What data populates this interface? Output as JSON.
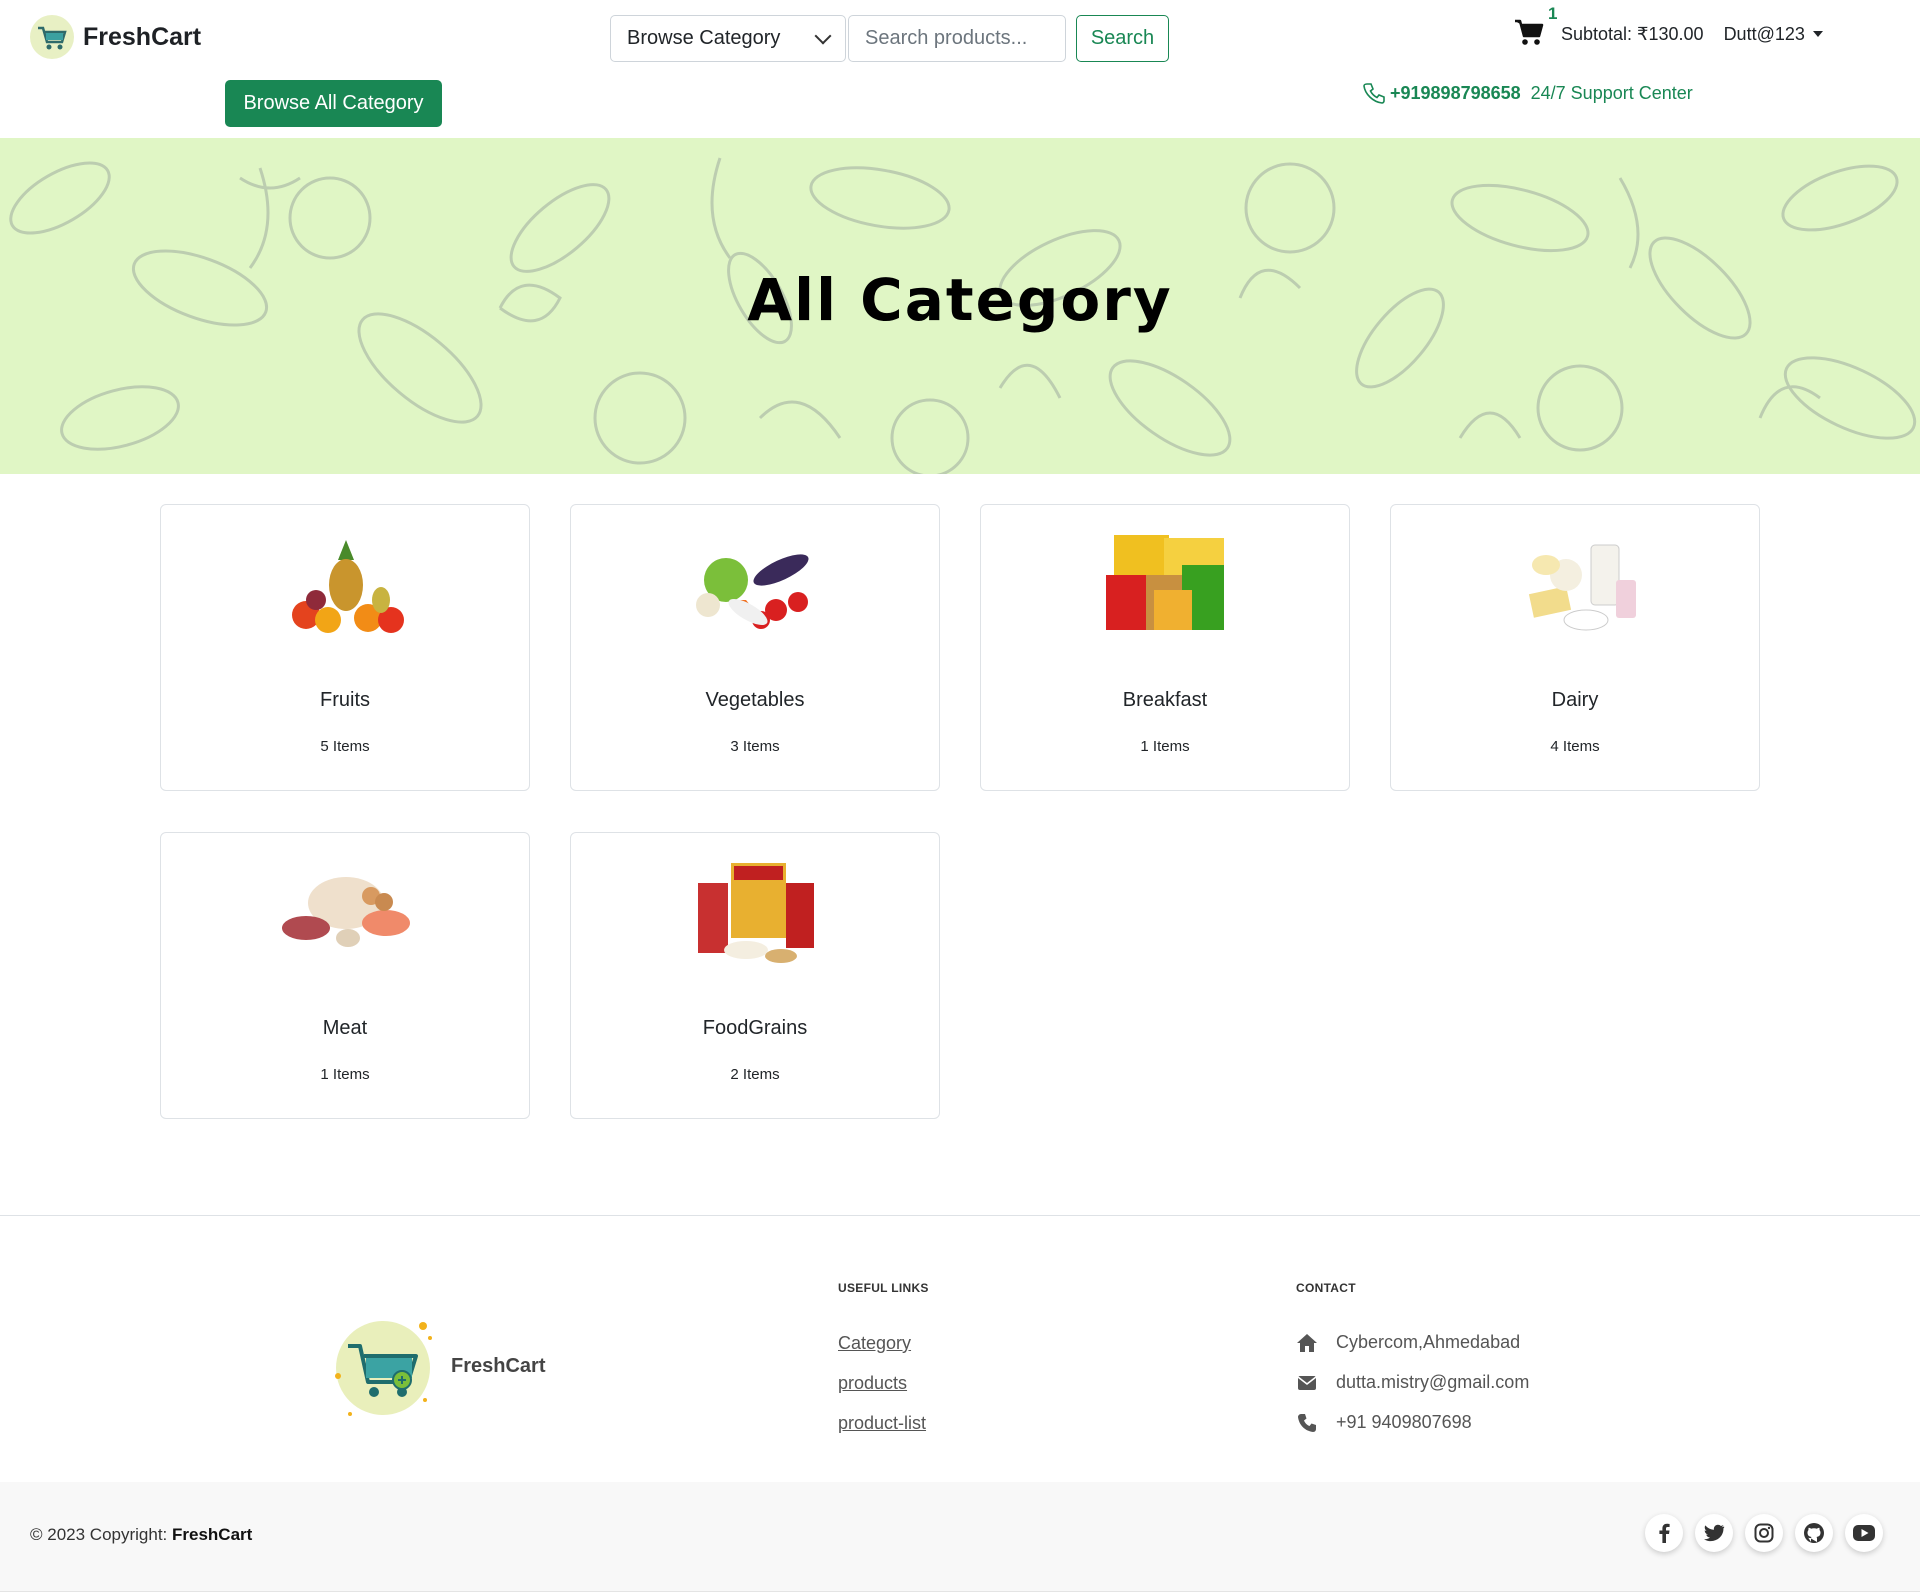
{
  "header": {
    "brand_name": "FreshCart",
    "category_select": "Browse Category",
    "search_placeholder": "Search products...",
    "search_button": "Search",
    "cart_count": "1",
    "subtotal": "Subtotal: ₹130.00",
    "user": "Dutt@123",
    "browse_all_button": "Browse All Category",
    "support_phone": "+919898798658",
    "support_text": "24/7 Support Center"
  },
  "hero": {
    "title": "All Category"
  },
  "categories": [
    {
      "name": "Fruits",
      "count": "5 Items",
      "icon": "fruits-image"
    },
    {
      "name": "Vegetables",
      "count": "3 Items",
      "icon": "vegetables-image"
    },
    {
      "name": "Breakfast",
      "count": "1 Items",
      "icon": "breakfast-image"
    },
    {
      "name": "Dairy",
      "count": "4 Items",
      "icon": "dairy-image"
    },
    {
      "name": "Meat",
      "count": "1 Items",
      "icon": "meat-image"
    },
    {
      "name": "FoodGrains",
      "count": "2 Items",
      "icon": "foodgrains-image"
    }
  ],
  "footer": {
    "brand_name": "FreshCart",
    "useful_links_heading": "USEFUL LINKS",
    "links": [
      "Category",
      "products",
      "product-list"
    ],
    "contact_heading": "CONTACT",
    "contacts": [
      {
        "icon": "home-icon",
        "text": "Cybercom,Ahmedabad"
      },
      {
        "icon": "envelope-icon",
        "text": "dutta.mistry@gmail.com"
      },
      {
        "icon": "phone-icon",
        "text": "+91 9409807698"
      }
    ],
    "copyright_prefix": "© 2023 Copyright:",
    "copyright_brand": "FreshCart",
    "socials": [
      "facebook-icon",
      "twitter-icon",
      "instagram-icon",
      "github-icon",
      "youtube-icon"
    ]
  },
  "colors": {
    "primary": "#198754",
    "hero_bg": "#e0f6c5",
    "border": "#dee2e6"
  }
}
